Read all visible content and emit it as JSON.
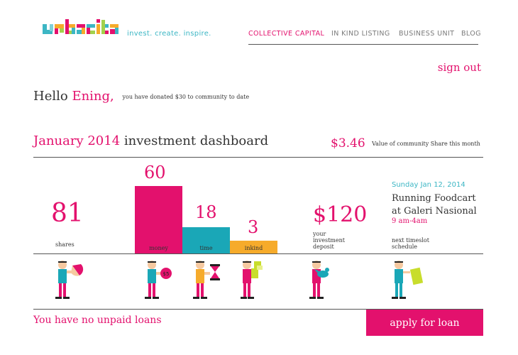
{
  "header": {
    "logo_text": "urbacita",
    "tagline": "invest. create. inspire.",
    "nav": [
      "COLLECTIVE CAPITAL",
      "IN KIND LISTING",
      "BUSINESS UNIT",
      "BLOG"
    ],
    "sign_out": "sign out"
  },
  "greeting": {
    "hello": "Hello",
    "name": "Ening,",
    "donation_text": "you have donated $30 to community to date"
  },
  "dashboard": {
    "month": "January 2014",
    "title": "investment dashboard",
    "share_value": "$3.46",
    "share_label": "Value of community Share this month"
  },
  "stats": {
    "shares": {
      "value": "81",
      "label": "shares"
    },
    "money": {
      "value": "60",
      "label": "money",
      "color": "#e3116d"
    },
    "time": {
      "value": "18",
      "label": "time",
      "color": "#1aa7b7"
    },
    "inkind": {
      "value": "3",
      "label": "inkind",
      "color": "#f6ab2b"
    },
    "deposit": {
      "value": "$120",
      "label_1": "your",
      "label_2": "investment",
      "label_3": "deposit"
    }
  },
  "event": {
    "date": "Sunday Jan 12, 2014",
    "title_1": "Running Foodcart",
    "title_2": "at Galeri Nasional",
    "time": "9 am-4am",
    "caption_1": "next timeslot",
    "caption_2": "schedule"
  },
  "illustrations": {
    "coin_label": "$5"
  },
  "loans": {
    "status": "You have no unpaid loans",
    "apply_label": "apply for loan"
  },
  "colors": {
    "accent": "#e3116d",
    "teal": "#1aa7b7",
    "orange": "#f6ab2b",
    "lime": "#c8dd2c"
  }
}
